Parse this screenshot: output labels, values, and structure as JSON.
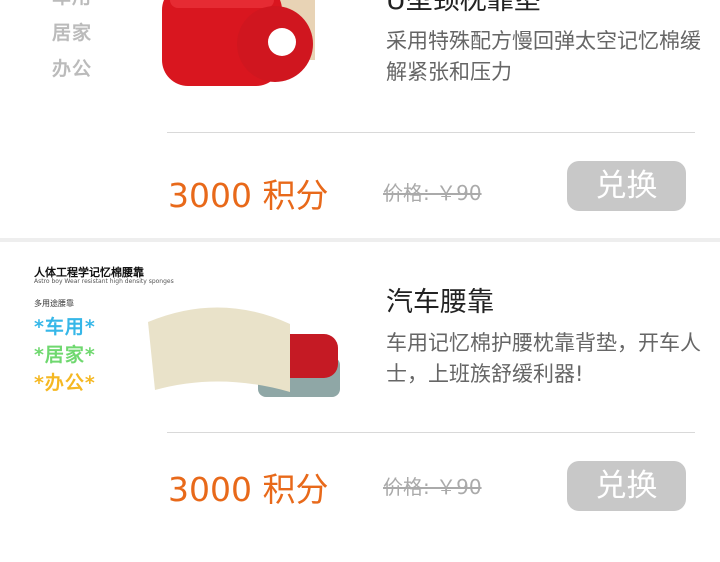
{
  "items": [
    {
      "tags": [
        "车用",
        "居家",
        "办公"
      ],
      "tag_colors": [
        "#bbbbbb",
        "#bbbbbb",
        "#bbbbbb"
      ],
      "title": "U型颈枕靠垫",
      "desc": "采用特殊配方慢回弹太空记忆棉缓解紧张和压力",
      "points": "3000 积分",
      "price": "价格: ￥90",
      "button": "兑换"
    },
    {
      "brand_title": "人体工程学记忆棉腰靠",
      "brand_sub": "Astro boy Wear resistant high density sponges",
      "brand_kind": "多用途腰靠",
      "tags": [
        "*车用*",
        "*居家*",
        "*办公*"
      ],
      "tag_colors": [
        "#36b7e8",
        "#6fd86f",
        "#f5b823"
      ],
      "title": "汽车腰靠",
      "desc": "车用记忆棉护腰枕靠背垫，开车人士，上班族舒缓利器!",
      "points": "3000 积分",
      "price": "价格: ￥90",
      "button": "兑换"
    }
  ]
}
